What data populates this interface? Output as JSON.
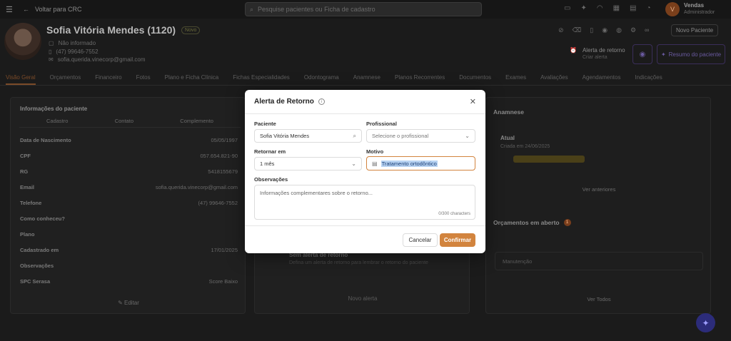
{
  "topbar": {
    "back_label": "Voltar para CRC",
    "search_placeholder": "Pesquise pacientes ou Ficha de cadastro",
    "user_initial": "V",
    "user_name": "Vendas",
    "user_role": "Administrador"
  },
  "patient": {
    "name": "Sofia Vitória Mendes (1120)",
    "badge": "Novo",
    "doc": "Não informado",
    "phone": "(47) 99646-7552",
    "email": "sofia.querida.vinecorp@gmail.com",
    "alert_label": "Alerta de retorno",
    "alert_sub": "Criar alerta",
    "summary_button": "Resumo do paciente",
    "new_patient_button": "Novo Paciente"
  },
  "tabs": [
    "Visão Geral",
    "Orçamentos",
    "Financeiro",
    "Fotos",
    "Plano e Ficha Clínica",
    "Fichas Especialidades",
    "Odontograma",
    "Anamnese",
    "Planos Recorrentes",
    "Documentos",
    "Exames",
    "Avaliações",
    "Agendamentos",
    "Indicações"
  ],
  "info_panel": {
    "title": "Informações do paciente",
    "columns": [
      "Cadastro",
      "Contato",
      "Complemento"
    ],
    "rows": [
      {
        "k": "Data de Nascimento",
        "v": "05/05/1997"
      },
      {
        "k": "CPF",
        "v": "057.654.821-90"
      },
      {
        "k": "RG",
        "v": "5418155679"
      },
      {
        "k": "Email",
        "v": "sofia.querida.vinecorp@gmail.com"
      },
      {
        "k": "Telefone",
        "v": "(47) 99646-7552"
      },
      {
        "k": "Como conheceu?",
        "v": ""
      },
      {
        "k": "Plano",
        "v": ""
      },
      {
        "k": "Cadastrado em",
        "v": "17/01/2025"
      },
      {
        "k": "Observações",
        "v": ""
      },
      {
        "k": "SPC Serasa",
        "v": "Score Baixo"
      }
    ],
    "edit_label": "Editar"
  },
  "mid_panel": {
    "title": "Sem alerta de retorno",
    "subtitle": "Defina um alerta de retorno para lembrar o retorno do paciente",
    "button": "Novo alerta"
  },
  "right_panel": {
    "anamnese_title": "Anamnese",
    "item_title": "Atual",
    "item_sub": "Criada em 24/06/2025",
    "see_previous": "Ver anteriores",
    "budgets_title": "Orçamentos em aberto",
    "budgets_count": "1",
    "budget_row": "Manutenção",
    "see_all": "Ver Todos"
  },
  "modal": {
    "title": "Alerta de Retorno",
    "patient_label": "Paciente",
    "patient_value": "Sofia Vitória Mendes",
    "professional_label": "Profissional",
    "professional_placeholder": "Selecione o profissional",
    "return_label": "Retornar em",
    "return_value": "1 mês",
    "reason_label": "Motivo",
    "reason_value": "Tratamento ortodôntico",
    "notes_label": "Observações",
    "notes_placeholder": "Informações complementares sobre o retorno...",
    "char_count": "0/300 characters",
    "cancel": "Cancelar",
    "confirm": "Confirmar"
  },
  "colors": {
    "accent": "#d2843e",
    "selection": "#b8d3f2"
  }
}
